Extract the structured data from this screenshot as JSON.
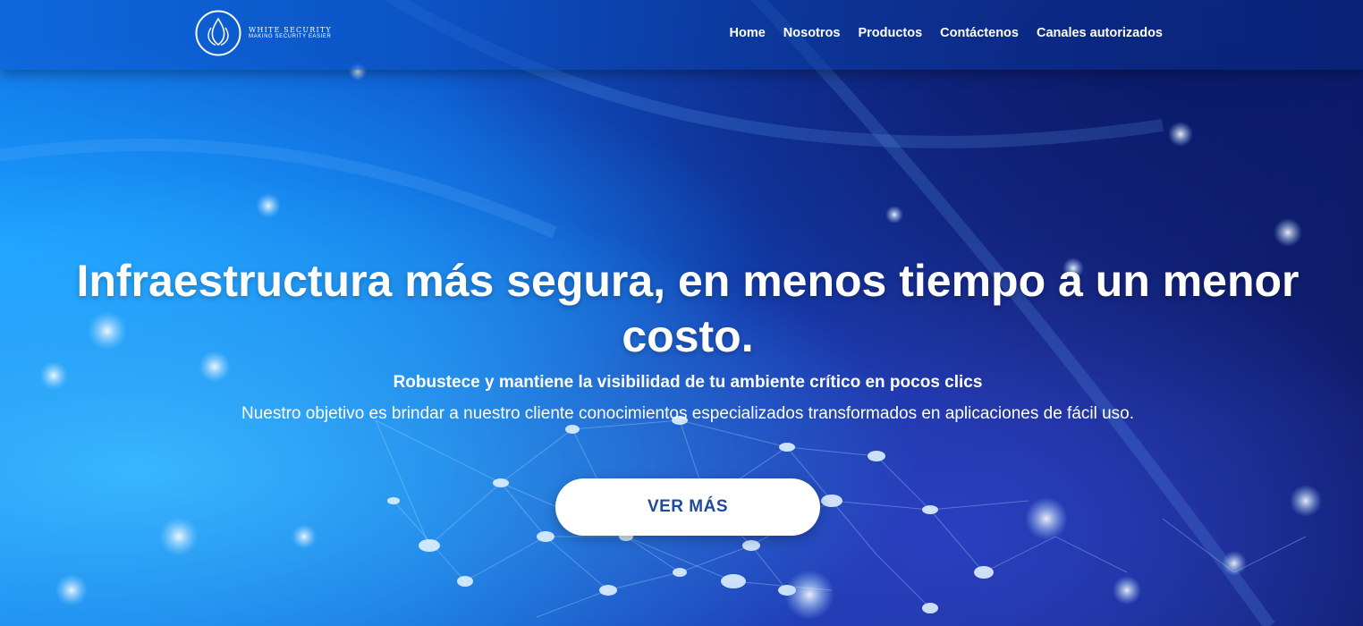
{
  "brand": {
    "name": "WHITE SECURITY",
    "tagline": "MAKING SECURITY EASIER"
  },
  "nav": {
    "items": [
      "Home",
      "Nosotros",
      "Productos",
      "Contáctenos",
      "Canales autorizados"
    ]
  },
  "hero": {
    "headline": "Infraestructura más segura, en menos tiempo a un menor costo.",
    "subheadline": "Robustece y mantiene la visibilidad de tu ambiente crítico en pocos clics",
    "description": "Nuestro objetivo es brindar a nuestro cliente conocimientos especializados transformados en aplicaciones de fácil uso.",
    "cta_label": "VER MÁS"
  },
  "colors": {
    "accent": "#1f4a9a",
    "background_left": "#1178e8",
    "background_right": "#0f1c6a"
  },
  "icons": {
    "logo": "flame-drop-logo-icon"
  }
}
